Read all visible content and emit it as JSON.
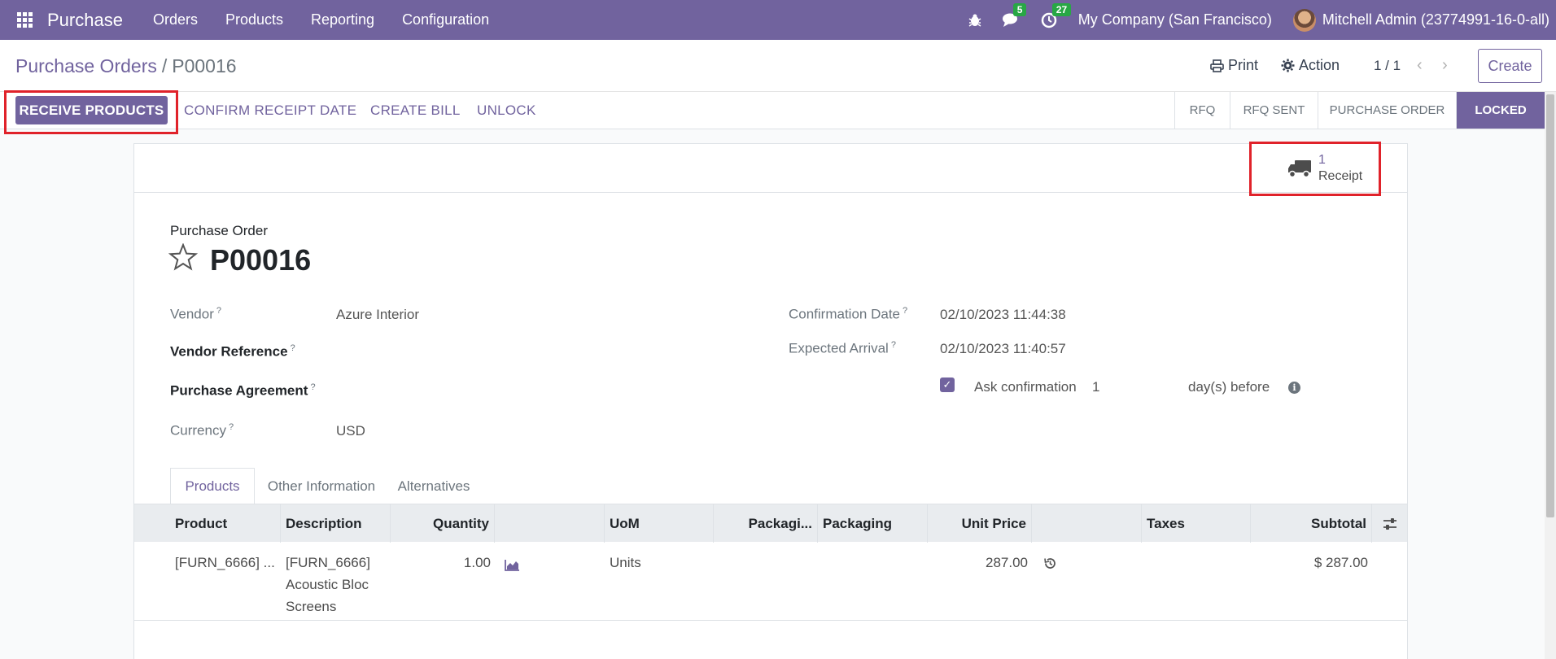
{
  "navbar": {
    "app_name": "Purchase",
    "menu": [
      "Orders",
      "Products",
      "Reporting",
      "Configuration"
    ],
    "messages_count": "5",
    "activities_count": "27",
    "company": "My Company (San Francisco)",
    "user": "Mitchell Admin (23774991-16-0-all)"
  },
  "control_panel": {
    "breadcrumb_parent": "Purchase Orders",
    "breadcrumb_current": "P00016",
    "print_label": "Print",
    "action_label": "Action",
    "pager": "1 / 1",
    "create_label": "Create"
  },
  "statusbar": {
    "buttons": {
      "receive": "RECEIVE PRODUCTS",
      "confirm_receipt": "CONFIRM RECEIPT DATE",
      "create_bill": "CREATE BILL",
      "unlock": "UNLOCK"
    },
    "stages": [
      "RFQ",
      "RFQ SENT",
      "PURCHASE ORDER",
      "LOCKED"
    ],
    "active_stage": "LOCKED"
  },
  "smart_button": {
    "count": "1",
    "label": "Receipt"
  },
  "form": {
    "doc_type": "Purchase Order",
    "name": "P00016",
    "vendor_label": "Vendor",
    "vendor_value": "Azure Interior",
    "vendor_ref_label": "Vendor Reference",
    "agreement_label": "Purchase Agreement",
    "currency_label": "Currency",
    "currency_value": "USD",
    "confirmation_label": "Confirmation Date",
    "confirmation_value": "02/10/2023 11:44:38",
    "arrival_label": "Expected Arrival",
    "arrival_value": "02/10/2023 11:40:57",
    "ask_label": "Ask confirmation",
    "ask_days": "1",
    "ask_suffix": "day(s) before",
    "help_mark": "?"
  },
  "tabs": [
    "Products",
    "Other Information",
    "Alternatives"
  ],
  "table": {
    "headers": {
      "product": "Product",
      "description": "Description",
      "quantity": "Quantity",
      "uom": "UoM",
      "packaging_qty": "Packagi...",
      "packaging": "Packaging",
      "unit_price": "Unit Price",
      "taxes": "Taxes",
      "subtotal": "Subtotal"
    },
    "rows": [
      {
        "product": "[FURN_6666] ...",
        "description_1": "[FURN_6666]",
        "description_2": "Acoustic Bloc",
        "description_3": "Screens",
        "quantity": "1.00",
        "uom": "Units",
        "unit_price": "287.00",
        "subtotal": "$ 287.00"
      }
    ]
  },
  "colors": {
    "brand": "#71639e",
    "highlight": "#e0222a",
    "badge": "#28a745"
  }
}
